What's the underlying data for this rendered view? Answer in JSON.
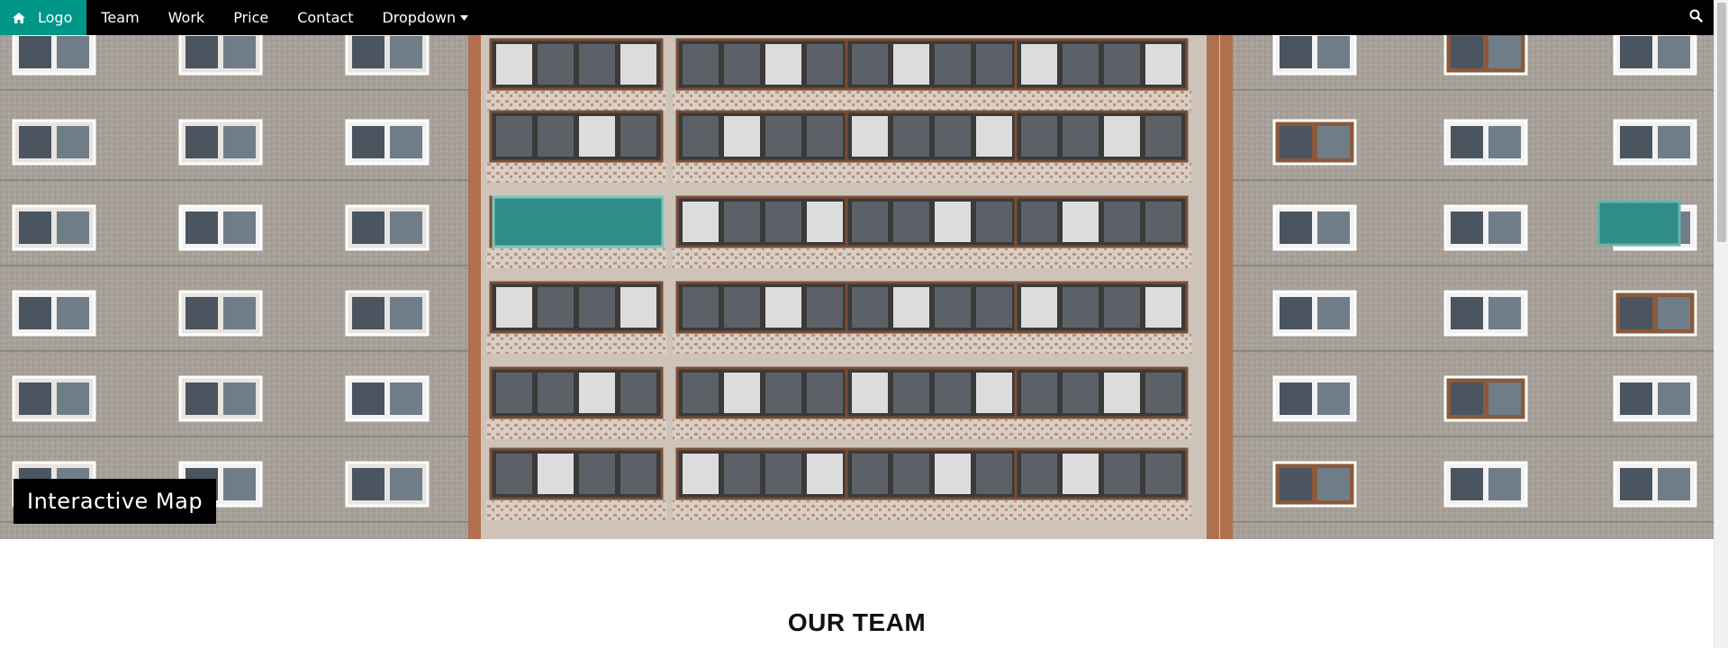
{
  "navbar": {
    "logo": {
      "label": "Logo",
      "icon": "home-icon"
    },
    "items": [
      {
        "label": "Team"
      },
      {
        "label": "Work"
      },
      {
        "label": "Price"
      },
      {
        "label": "Contact"
      }
    ],
    "dropdown": {
      "label": "Dropdown",
      "icon": "caret-down-icon"
    },
    "search": {
      "icon": "search-icon"
    },
    "colors": {
      "background": "#000000",
      "active": "#009688",
      "text": "#ffffff"
    }
  },
  "hero": {
    "image": "apartment-building-facade",
    "label": "Interactive Map"
  },
  "section": {
    "title": "OUR TEAM"
  }
}
